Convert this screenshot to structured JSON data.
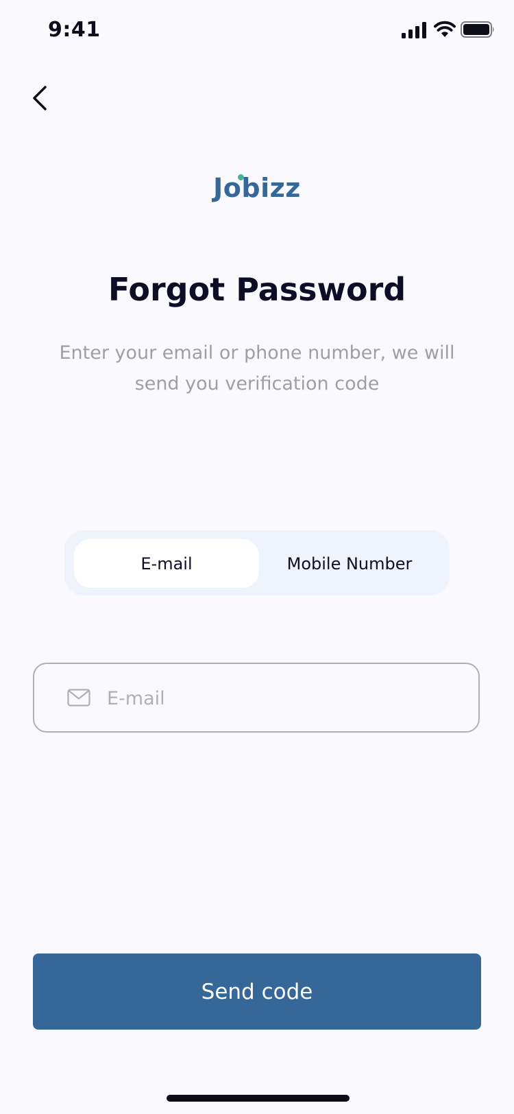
{
  "status_bar": {
    "time": "9:41"
  },
  "header": {
    "back_icon": "chevron-left-icon"
  },
  "logo": {
    "text": "Jobizz"
  },
  "page": {
    "title": "Forgot Password",
    "subtitle": "Enter your email or phone number, we will send you verification code"
  },
  "segment": {
    "options": [
      {
        "label": "E-mail",
        "selected": true
      },
      {
        "label": "Mobile Number",
        "selected": false
      }
    ]
  },
  "email_field": {
    "placeholder": "E-mail",
    "value": "",
    "icon": "mail-icon"
  },
  "send_button": {
    "label": "Send code"
  },
  "colors": {
    "primary": "#356899",
    "accent_dot": "#4AB29A",
    "background": "#F9F9FE",
    "segment_bg": "#EFF3FB"
  }
}
